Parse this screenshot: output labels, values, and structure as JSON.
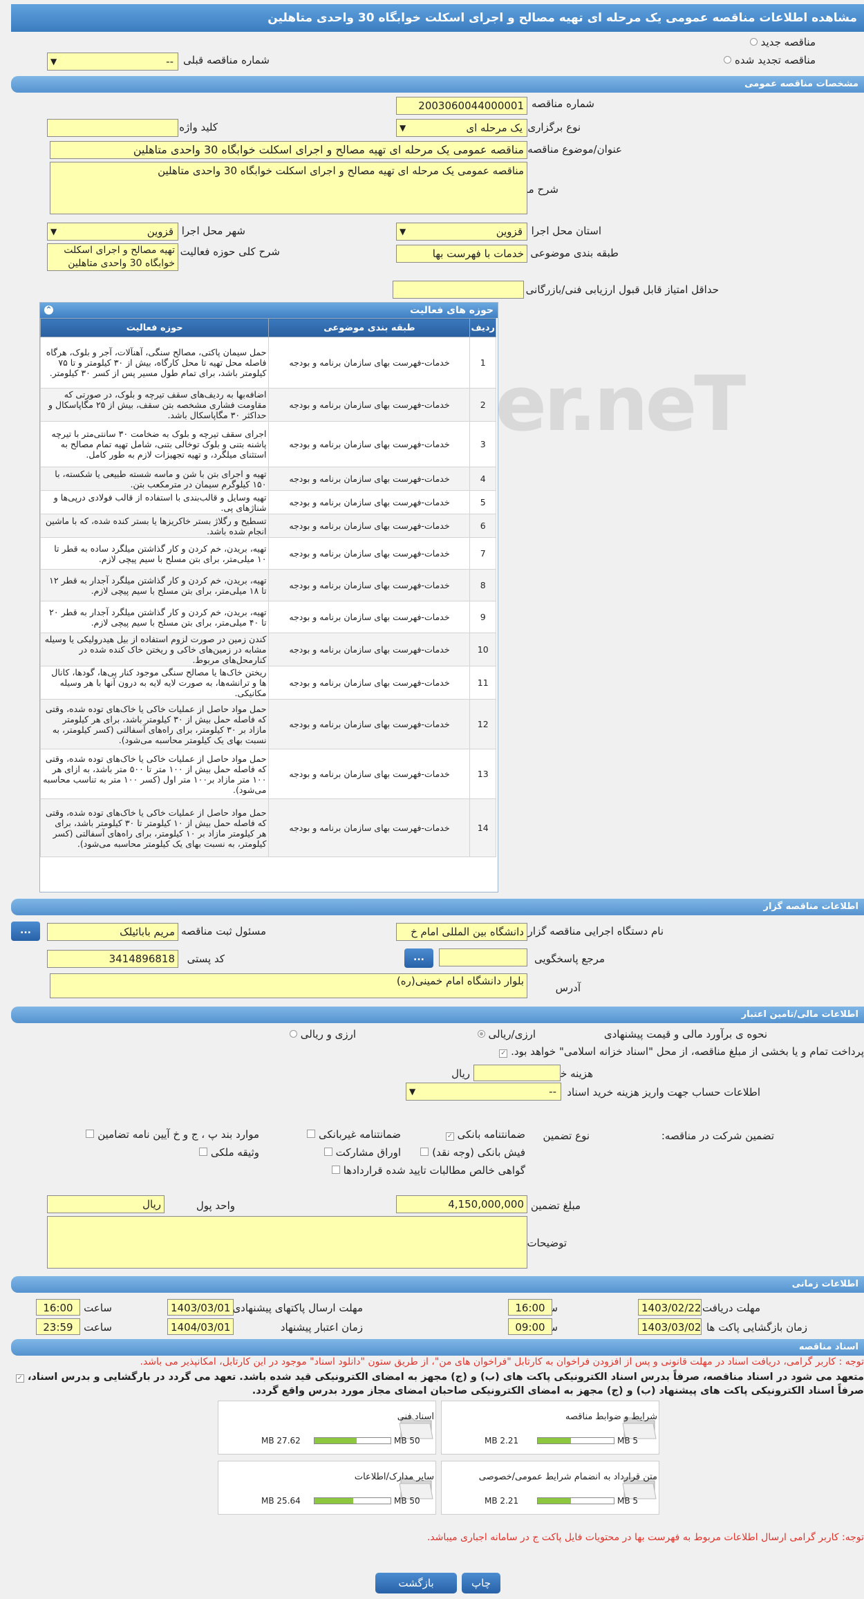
{
  "title": "مشاهده اطلاعات مناقصه عمومی یک مرحله ای تهیه مصالح و اجرای اسکلت خوابگاه 30 واحدی متاهلین",
  "top": {
    "new_label": "مناقصه جدید",
    "renewed_label": "مناقصه تجدید شده",
    "prev_label": "شماره مناقصه قبلی",
    "prev_value": "--"
  },
  "general": {
    "section": "مشخصات مناقصه عمومی",
    "number_label": "شماره مناقصه",
    "number_value": "2003060044000001",
    "type_label": "نوع برگزاری",
    "type_value": "یک مرحله ای",
    "keyword_label": "کلید واژه",
    "subject_label": "عنوان/موضوع مناقصه",
    "subject_value": "مناقصه عمومی یک مرحله ای تهیه مصالح و اجرای اسکلت خوابگاه 30 واحدی متاهلین",
    "desc_label": "شرح مناقصه",
    "desc_value": "مناقصه عمومی یک مرحله ای تهیه مصالح و اجرای اسکلت خوابگاه 30 واحدی متاهلین",
    "province_label": "استان محل اجرا",
    "province_value": "قزوین",
    "city_label": "شهر محل اجرا",
    "city_value": "قزوین",
    "category_label": "طبقه بندی موضوعی",
    "category_value": "خدمات با فهرست بها",
    "scope_label": "شرح کلی حوزه فعالیت",
    "scope_value": "تهیه مصالح و اجرای اسکلت خوابگاه 30 واحدی متاهلین",
    "minscore_label": "حداقل امتیاز قابل قبول ارزیابی فنی/بازرگانی"
  },
  "activities": {
    "header": "حوزه های فعالیت",
    "col_row": "ردیف",
    "col_cat": "طبقه بندی موضوعی",
    "col_act": "حوزه فعالیت",
    "rows": [
      {
        "n": "1",
        "cat": "خدمات-فهرست بهای سازمان برنامه و بودجه",
        "act": "حمل سیمان پاکتی، مصالح سنگی، آهنآلات، آجر و بلوک، هرگاه فاصله محل تهیه تا محل کارگاه، بیش از ۳۰ کیلومتر و تا ۷۵ کیلومتر باشد، برای تمام طول مسیر پس از کسر ۳۰ کیلومتر."
      },
      {
        "n": "2",
        "cat": "خدمات-فهرست بهای سازمان برنامه و بودجه",
        "act": "اضافه‌بها به ردیف‌های سقف تیرچه و بلوک، در صورتی که مقاومت فشاری مشخصه بتن سقف، بیش از ۲۵ مگاپاسکال و حداکثر ۳۰ مگاپاسکال باشد."
      },
      {
        "n": "3",
        "cat": "خدمات-فهرست بهای سازمان برنامه و بودجه",
        "act": "اجرای سقف تیرچه و بلوک به ضخامت ۳۰ سانتی‌متر با تیرچه پاشنه بتنی و بلوک توخالی بتنی، شامل تهیه تمام مصالح به استثنای میلگرد، و تهیه تجهیزات لازم به طور کامل."
      },
      {
        "n": "4",
        "cat": "خدمات-فهرست بهای سازمان برنامه و بودجه",
        "act": "تهیه و اجرای بتن با شن و ماسه شسته طبیعی یا شکسته، با ۱۵۰ کیلوگرم سیمان در مترمکعب بتن."
      },
      {
        "n": "5",
        "cat": "خدمات-فهرست بهای سازمان برنامه و بودجه",
        "act": "تهیه وسایل و قالب‌بندی با استفاده از قالب فولادی درپی‌ها و شناژهای پی."
      },
      {
        "n": "6",
        "cat": "خدمات-فهرست بهای سازمان برنامه و بودجه",
        "act": "تسطیح و رگلاژ بستر خاکریزها یا بستر کنده شده، که با ماشین انجام شده باشد."
      },
      {
        "n": "7",
        "cat": "خدمات-فهرست بهای سازمان برنامه و بودجه",
        "act": "تهیه، بریدن، خم کردن و کار گذاشتن میلگرد ساده به قطر تا ۱۰ میلی‌متر، برای بتن مسلح با سیم پیچی لازم."
      },
      {
        "n": "8",
        "cat": "خدمات-فهرست بهای سازمان برنامه و بودجه",
        "act": "تهیه، بریدن، خم کردن و کار گذاشتن میلگرد آجدار به قطر ۱۲ تا ۱۸ میلی‌متر، برای بتن مسلح با سیم پیچی لازم."
      },
      {
        "n": "9",
        "cat": "خدمات-فهرست بهای سازمان برنامه و بودجه",
        "act": "تهیه، بریدن، خم کردن و کار گذاشتن میلگرد آجدار به قطر ۲۰ تا ۴۰ میلی‌متر، برای بتن مسلح با سیم پیچی لازم."
      },
      {
        "n": "10",
        "cat": "خدمات-فهرست بهای سازمان برنامه و بودجه",
        "act": "کندن زمین در صورت لزوم استفاده از بیل هیدرولیکی یا وسیله مشابه در زمین‌های خاکی و ریختن خاک کنده شده در کنارمحل‌های مربوط."
      },
      {
        "n": "11",
        "cat": "خدمات-فهرست بهای سازمان برنامه و بودجه",
        "act": "ریختن خاک‌ها یا مصالح سنگی موجود کنار پی‌ها، گودها، کانال ها و ترانشه‌ها، به صورت لایه لایه به درون آنها با هر وسیله مکانیکی."
      },
      {
        "n": "12",
        "cat": "خدمات-فهرست بهای سازمان برنامه و بودجه",
        "act": "حمل مواد حاصل از عملیات خاکی یا خاک‌های توده شده، وقتی که فاصله حمل بیش از ۳۰ کیلومتر باشد، برای هر کیلومتر مازاد بر ۳۰ کیلومتر، برای راه‌های آسفالتی (کسر کیلومتر، به نسبت بهای یک کیلومتر محاسبه می‌شود)."
      },
      {
        "n": "13",
        "cat": "خدمات-فهرست بهای سازمان برنامه و بودجه",
        "act": "حمل مواد حاصل از عملیات خاکی یا خاک‌های توده شده، وقتی که فاصله حمل بیش از ۱۰۰ متر تا ۵۰۰ متر باشد، به ازای هر ۱۰۰ متر مازاد بر۱۰۰ متر اول (کسر ۱۰۰ متر به تناسب محاسبه می‌شود)."
      },
      {
        "n": "14",
        "cat": "خدمات-فهرست بهای سازمان برنامه و بودجه",
        "act": "حمل مواد حاصل از عملیات خاکی یا خاک‌های توده شده، وقتی که فاصله حمل بیش از ۱۰ کیلومتر تا ۳۰ کیلومتر باشد، برای هر کیلومتر مازاد بر ۱۰ کیلومتر، برای راه‌های آسفالتی (کسر کیلومتر، به نسبت بهای یک کیلومتر محاسبه می‌شود)."
      }
    ]
  },
  "organizer": {
    "section": "اطلاعات مناقصه گزار",
    "org_label": "نام دستگاه اجرایی مناقصه گزار",
    "org_value": "دانشگاه بین المللی امام خ",
    "resp_label": "مسئول ثبت مناقصه",
    "resp_value": "مریم بابائیلک",
    "ref_label": "مرجع پاسخگویی",
    "postal_label": "کد پستی",
    "postal_value": "3414896818",
    "addr_label": "آدرس",
    "addr_value": "بلوار دانشگاه امام خمینی(ره)",
    "dots": "..."
  },
  "finance": {
    "section": "اطلاعات مالی/تامین اعتبار",
    "method_label": "نحوه ی برآورد مالی و قیمت پیشنهادی",
    "rial_label": "ارزی/ریالی",
    "fx_label": "ارزی و ریالی",
    "treasury_text": "پرداخت تمام و یا بخشی از مبلغ مناقصه، از محل \"اسناد خزانه اسلامی\" خواهد بود.",
    "doc_cost_label": "هزینه خرید اسناد",
    "doc_cost_unit": "ریال",
    "account_label": "اطلاعات حساب جهت واریز هزینه خرید اسناد",
    "account_value": "--",
    "guarantee_label": "تضمین شرکت در مناقصه:",
    "gtype_label": "نوع تضمین",
    "g_bank": "ضمانتنامه بانکی",
    "g_nonbank": "ضمانتنامه غیربانکی",
    "g_items": "موارد بند پ ، ج و خ آیین نامه تضامین",
    "g_cheque": "فیش بانکی (وجه نقد)",
    "g_bonds": "اوراق مشارکت",
    "g_property": "وثیقه ملکی",
    "g_claims": "گواهی خالص مطالبات تایید شده قراردادها",
    "amount_label": "مبلغ تضمین",
    "amount_value": "4,150,000,000",
    "currency_label": "واحد پول",
    "currency_value": "ریال",
    "notes_label": "توضیحات"
  },
  "timing": {
    "section": "اطلاعات زمانی",
    "doc_receive_label": "مهلت دریافت اسناد",
    "doc_receive_date": "1403/02/22",
    "doc_receive_time": "16:00",
    "submit_label": "مهلت ارسال پاکتهای پیشنهادی",
    "submit_date": "1403/03/01",
    "submit_time": "16:00",
    "open_label": "زمان بازگشایی پاکت ها",
    "open_date": "1403/03/02",
    "open_time": "09:00",
    "validity_label": "زمان اعتبار پیشنهاد",
    "validity_date": "1404/03/01",
    "validity_time": "23:59",
    "time_label": "ساعت"
  },
  "documents": {
    "section": "اسناد مناقصه",
    "note1": "توجه : کاربر گرامی، دریافت اسناد در مهلت قانونی و پس از افزودن فراخوان به کارتابل \"فراخوان های من\"، از طریق ستون \"دانلود اسناد\" موجود در این کارتابل، امکانپذیر می باشد.",
    "commit1": "متعهد می شود در اسناد مناقصه، صرفاً بدرس اسناد الکترونیکی پاکت های (ب) و (ج) مجهز به امضای الکترونیکی قید شده باشد. تعهد می گردد در بارگشایی و بدرس اسناد،",
    "commit2": "صرفاً اسناد الکترونیکی پاکت های پیشنهاد (ب) و (ج) مجهز به امضای الکترونیکی صاحبان امضای مجاز مورد بدرس واقع گردد.",
    "items": [
      {
        "name": "شرایط و ضوابط مناقصه",
        "size": "2.21 MB",
        "max": "5 MB",
        "fill": 0.44
      },
      {
        "name": "اسناد فنی",
        "size": "27.62 MB",
        "max": "50 MB",
        "fill": 0.55
      },
      {
        "name": "متن قرارداد به انضمام شرایط عمومی/خصوصی",
        "size": "2.21 MB",
        "max": "5 MB",
        "fill": 0.44
      },
      {
        "name": "سایر مدارک/اطلاعات",
        "size": "25.64 MB",
        "max": "50 MB",
        "fill": 0.51
      }
    ],
    "note2": "توجه: کاربر گرامی ارسال اطلاعات مربوط به فهرست بها در محتویات فایل پاکت ج در سامانه اجباری میباشد."
  },
  "buttons": {
    "print": "چاپ",
    "back": "بازگشت"
  },
  "watermark": "AriaTender.neT"
}
